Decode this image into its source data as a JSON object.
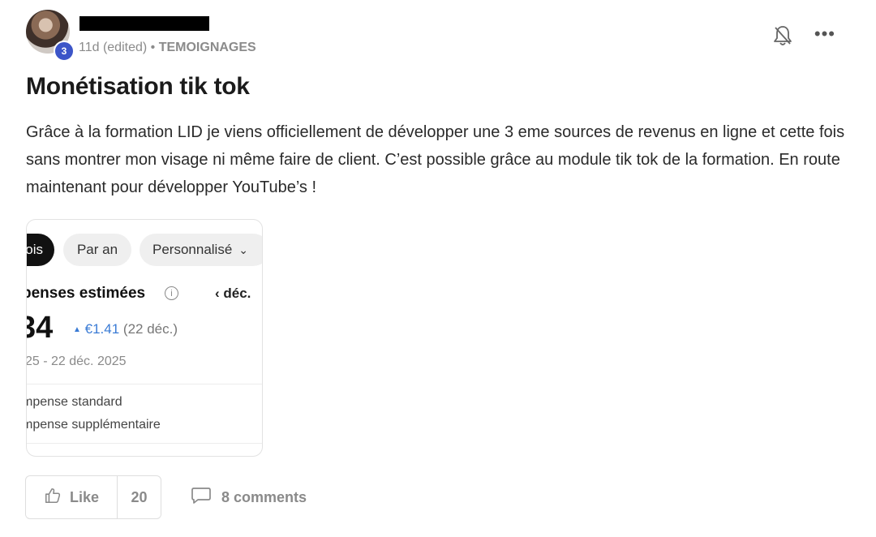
{
  "post": {
    "author_level": "3",
    "meta_time": "11d (edited)",
    "meta_sep": " • ",
    "meta_category": "TEMOIGNAGES",
    "more_label": "•••",
    "title": "Monétisation tik tok",
    "body": "Grâce à la formation LID je viens officiellement de développer une 3 eme sources de revenus en ligne et cette fois sans montrer mon visage ni même faire de client. C’est possible grâce au module tik tok de la formation. En route maintenant pour développer YouTube’s !"
  },
  "attachment": {
    "pill_period_partial": "ois",
    "pill_year": "Par an",
    "pill_custom": "Personnalisé",
    "pill_custom_chevron": "⌄",
    "estimate_title": "penses estimées",
    "info_glyph": "i",
    "prev_month": "‹  déc.",
    "big_value": "34",
    "delta_arrow": "▲",
    "delta_value": "€1.41",
    "delta_date": "(22 déc.)",
    "date_range": "25 - 22 déc. 2025",
    "reward_standard": "mpense standard",
    "reward_extra": "mpense supplémentaire"
  },
  "actions": {
    "like_label": "Like",
    "like_count": "20",
    "comments_label": "8 comments"
  },
  "colors": {
    "badge": "#3c55c8",
    "delta": "#3a7bd5",
    "muted": "#8a8a8a"
  },
  "icons": [
    "bell-off-icon",
    "more-icon",
    "info-icon",
    "thumbs-up-icon",
    "comment-icon"
  ]
}
